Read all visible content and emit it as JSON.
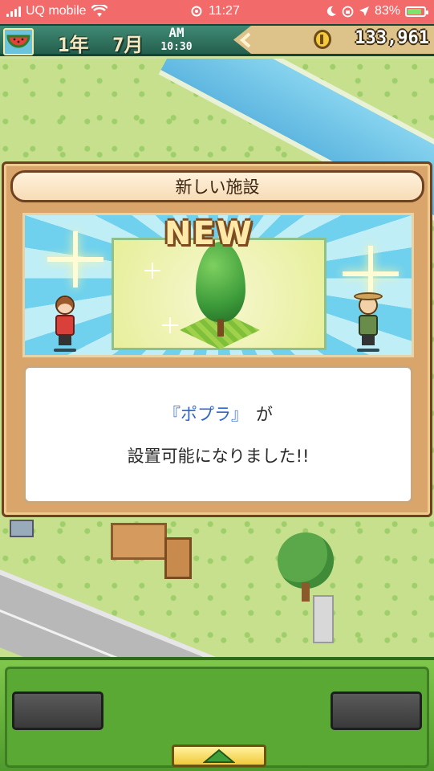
{
  "status_bar": {
    "carrier": "UQ mobile",
    "time": "11:27",
    "battery": "83%",
    "battery_level": 0.83,
    "icons": [
      "signal-icon",
      "wifi-icon",
      "alarm-icon",
      "moon-icon",
      "location-icon",
      "charging-icon"
    ]
  },
  "top_bar": {
    "year": "1年",
    "month": "7月",
    "ampm": "AM",
    "clock": "10:30",
    "money": "133,961",
    "icons": [
      "watermelon-icon",
      "coin-icon",
      "back-arrow-icon"
    ]
  },
  "dialog": {
    "title": "新しい施設",
    "new_badge": "NEW",
    "item_name": "『ポプラ』",
    "particle": "が",
    "message_line2": "設置可能になりました!!"
  },
  "colors": {
    "status_bar": "#f26a6a",
    "top_bar": "#2f735f",
    "dialog_frame": "#d9a56b",
    "item_name": "#2f66c9",
    "toolbar": "#5aa935"
  }
}
